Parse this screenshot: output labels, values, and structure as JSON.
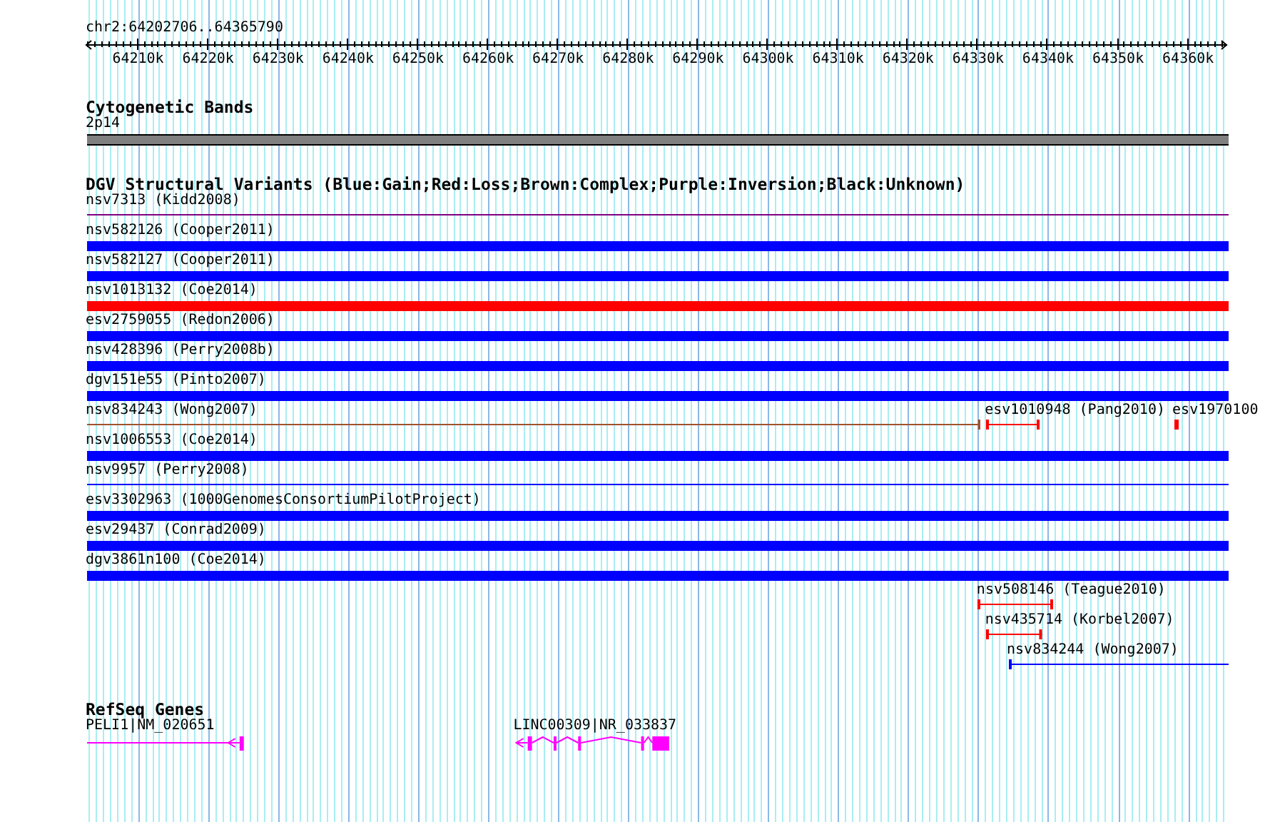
{
  "ruler": {
    "label": "chr2:64202706..64365790",
    "ticks": [
      "64210k",
      "64220k",
      "64230k",
      "64240k",
      "64250k",
      "64260k",
      "64270k",
      "64280k",
      "64290k",
      "64300k",
      "64310k",
      "64320k",
      "64330k",
      "64340k",
      "64350k",
      "64360k"
    ]
  },
  "cytogenetic_bands": {
    "title": "Cytogenetic Bands",
    "band": "2p14"
  },
  "dgv_track": {
    "title": "DGV Structural Variants (Blue:Gain;Red:Loss;Brown:Complex;Purple:Inversion;Black:Unknown)",
    "rows": [
      {
        "features": [
          {
            "label": "nsv7313 (Kidd2008)",
            "kind": "line",
            "color": "#800080"
          }
        ]
      },
      {
        "features": [
          {
            "label": "nsv582126 (Cooper2011)",
            "kind": "bar",
            "color": "#0000ff"
          }
        ]
      },
      {
        "features": [
          {
            "label": "nsv582127 (Cooper2011)",
            "kind": "bar",
            "color": "#0000ff"
          }
        ]
      },
      {
        "features": [
          {
            "label": "nsv1013132 (Coe2014)",
            "kind": "bar",
            "color": "#ff0000"
          }
        ]
      },
      {
        "features": [
          {
            "label": "esv2759055 (Redon2006)",
            "kind": "bar",
            "color": "#0000ff"
          }
        ]
      },
      {
        "features": [
          {
            "label": "nsv428396 (Perry2008b)",
            "kind": "bar",
            "color": "#0000ff"
          }
        ]
      },
      {
        "features": [
          {
            "label": "dgv151e55 (Pinto2007)",
            "kind": "bar",
            "color": "#0000ff"
          }
        ]
      },
      {
        "features": [
          {
            "label": "nsv834243 (Wong2007)",
            "kind": "line",
            "color": "#a0522d"
          },
          {
            "label": "esv1010948 (Pang2010)",
            "kind": "line",
            "color": "#ff0000"
          },
          {
            "label": "esv1970100",
            "kind": "line",
            "color": "#ff0000"
          }
        ]
      },
      {
        "features": [
          {
            "label": "nsv1006553 (Coe2014)",
            "kind": "bar",
            "color": "#0000ff"
          }
        ]
      },
      {
        "features": [
          {
            "label": "nsv9957 (Perry2008)",
            "kind": "line",
            "color": "#0000ff"
          }
        ]
      },
      {
        "features": [
          {
            "label": "esv3302963 (1000GenomesConsortiumPilotProject)",
            "kind": "bar",
            "color": "#0000ff"
          }
        ]
      },
      {
        "features": [
          {
            "label": "esv29437 (Conrad2009)",
            "kind": "bar",
            "color": "#0000ff"
          }
        ]
      },
      {
        "features": [
          {
            "label": "dgv3861n100 (Coe2014)",
            "kind": "bar",
            "color": "#0000ff"
          }
        ]
      },
      {
        "features": [
          {
            "label": "nsv508146 (Teague2010)",
            "kind": "line",
            "color": "#ff0000"
          }
        ]
      },
      {
        "features": [
          {
            "label": "nsv435714 (Korbel2007)",
            "kind": "line",
            "color": "#ff0000"
          }
        ]
      },
      {
        "features": [
          {
            "label": "nsv834244 (Wong2007)",
            "kind": "line",
            "color": "#0000ff"
          }
        ]
      }
    ]
  },
  "refseq_genes": {
    "title": "RefSeq Genes",
    "genes": [
      {
        "label": "PELI1|NM_020651"
      },
      {
        "label": "LINC00309|NR_033837"
      }
    ]
  }
}
